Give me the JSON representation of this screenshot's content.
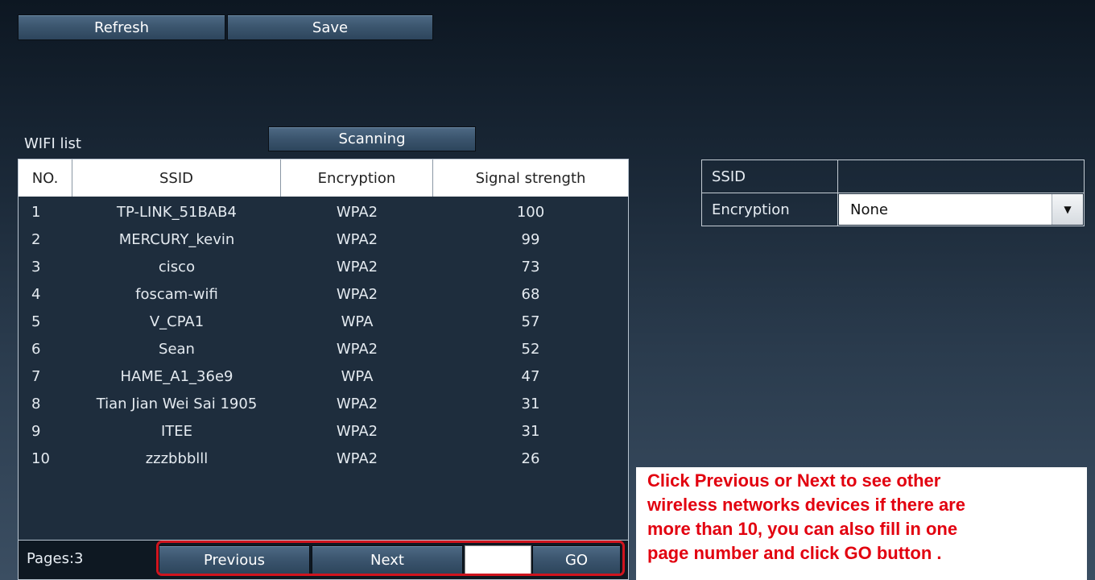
{
  "toolbar": {
    "refresh_label": "Refresh",
    "save_label": "Save"
  },
  "wifi_list": {
    "title": "WIFI list",
    "scan_label": "Scanning",
    "columns": [
      "NO.",
      "SSID",
      "Encryption",
      "Signal strength"
    ],
    "rows": [
      {
        "no": "1",
        "ssid": "TP-LINK_51BAB4",
        "encryption": "WPA2",
        "signal": "100"
      },
      {
        "no": "2",
        "ssid": "MERCURY_kevin",
        "encryption": "WPA2",
        "signal": "99"
      },
      {
        "no": "3",
        "ssid": "cisco",
        "encryption": "WPA2",
        "signal": "73"
      },
      {
        "no": "4",
        "ssid": "foscam-wifi",
        "encryption": "WPA2",
        "signal": "68"
      },
      {
        "no": "5",
        "ssid": "V_CPA1",
        "encryption": "WPA",
        "signal": "57"
      },
      {
        "no": "6",
        "ssid": "Sean",
        "encryption": "WPA2",
        "signal": "52"
      },
      {
        "no": "7",
        "ssid": "HAME_A1_36e9",
        "encryption": "WPA",
        "signal": "47"
      },
      {
        "no": "8",
        "ssid": "Tian Jian Wei Sai 1905",
        "encryption": "WPA2",
        "signal": "31"
      },
      {
        "no": "9",
        "ssid": "ITEE",
        "encryption": "WPA2",
        "signal": "31"
      },
      {
        "no": "10",
        "ssid": "zzzbbblll",
        "encryption": "WPA2",
        "signal": "26"
      }
    ]
  },
  "pager": {
    "pages_label": "Pages:3",
    "previous_label": "Previous",
    "next_label": "Next",
    "page_input_value": "",
    "go_label": "GO"
  },
  "form": {
    "ssid_label": "SSID",
    "ssid_value": "",
    "encryption_label": "Encryption",
    "encryption_value": "None"
  },
  "annotation": {
    "text": "Click Previous or Next to see other\nwireless networks devices if there are\nmore than 10,  you can also fill in one\npage number and click GO button ."
  },
  "colors": {
    "annotation_text": "#e2000f",
    "highlight_border": "#d0141e"
  }
}
